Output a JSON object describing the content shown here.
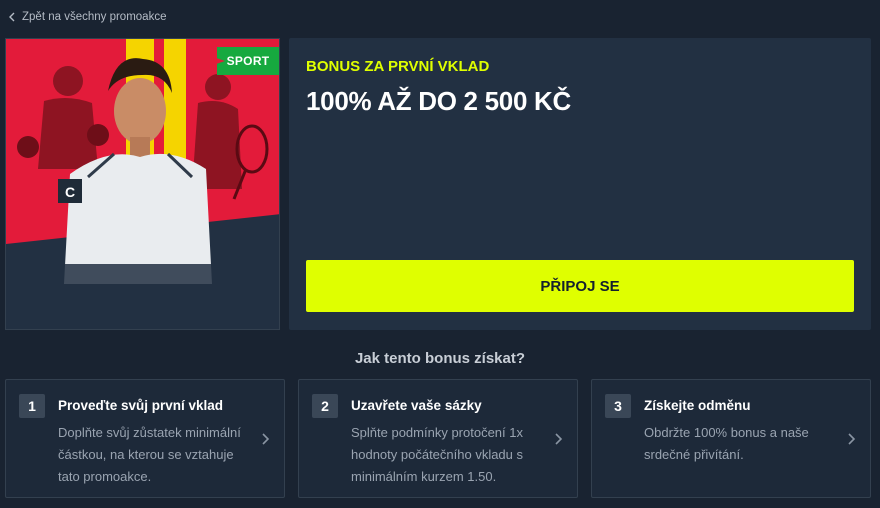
{
  "nav": {
    "back_label": "Zpět na všechny promoakce"
  },
  "promo": {
    "badge": "SPORT",
    "kicker": "BONUS ZA PRVNÍ VKLAD",
    "headline": "100% AŽ DO 2 500 KČ",
    "cta_label": "PŘIPOJ SE"
  },
  "how_to": {
    "title": "Jak tento bonus získat?",
    "steps": [
      {
        "number": "1",
        "title": "Proveďte svůj první vklad",
        "text": "Doplňte svůj zůstatek minimální částkou, na kterou se vztahuje tato promoakce."
      },
      {
        "number": "2",
        "title": "Uzavřete vaše sázky",
        "text": "Splňte podmínky protočení 1x hodnoty počátečního vkladu s minimálním kurzem 1.50."
      },
      {
        "number": "3",
        "title": "Získejte odměnu",
        "text": "Obdržte 100% bonus a naše srdečné přivítání."
      }
    ]
  },
  "colors": {
    "background": "#192331",
    "panel": "#223042",
    "accent_yellow": "#dfff00",
    "badge_green": "#16a93f",
    "hero_red": "#e31b3a"
  },
  "icons": {
    "back": "chevron-left-icon",
    "step_arrow": "chevron-right-icon"
  }
}
